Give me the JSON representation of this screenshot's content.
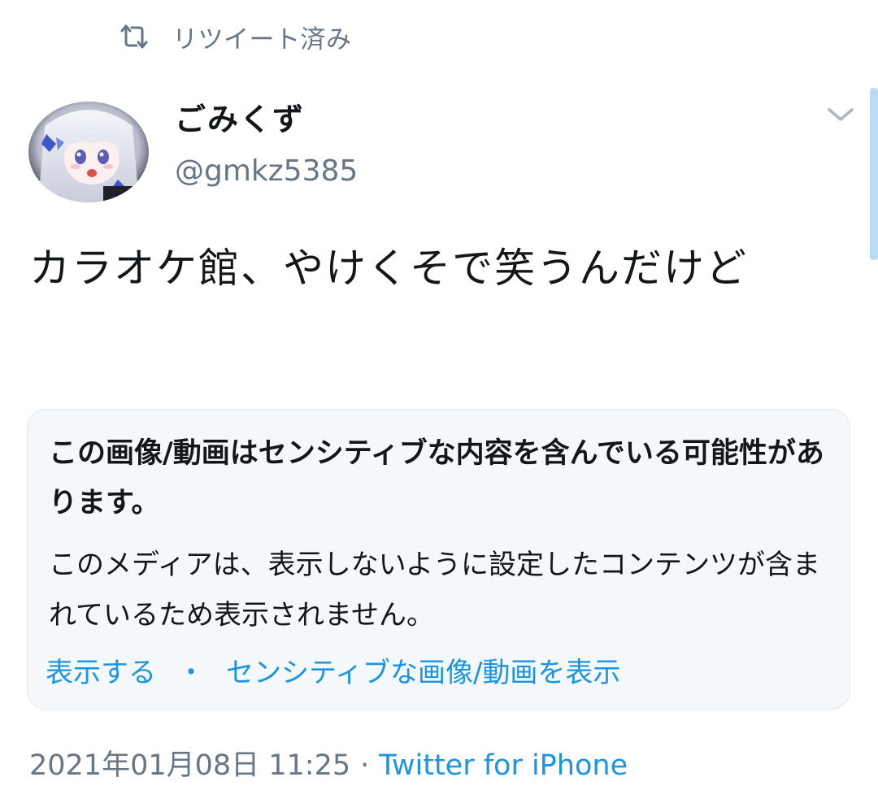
{
  "retweet": {
    "icon": "retweet-icon",
    "label": "リツイート済み"
  },
  "author": {
    "display_name": "ごみくず",
    "handle": "@gmkz5385",
    "avatar": "avatar-anime-girl"
  },
  "tweet": {
    "text": "カラオケ館、やけくそで笑うんだけど"
  },
  "sensitive_media": {
    "title": "この画像/動画はセンシティブな内容を含んでいる可能性があります。",
    "body": "このメディアは、表示しないように設定したコンテンツが含まれているため表示されません。",
    "show_label": "表示する",
    "separator": "・",
    "show_always_label": "センシティブな画像/動画を表示"
  },
  "meta": {
    "timestamp": "2021年01月08日 11:25",
    "separator": "·",
    "source": "Twitter for iPhone"
  },
  "colors": {
    "link": "#1b95e0",
    "secondary_text": "#657786",
    "card_background": "#f5f8fa",
    "card_border": "#dfe5ea",
    "scrollbar": "#b9dcf6"
  }
}
